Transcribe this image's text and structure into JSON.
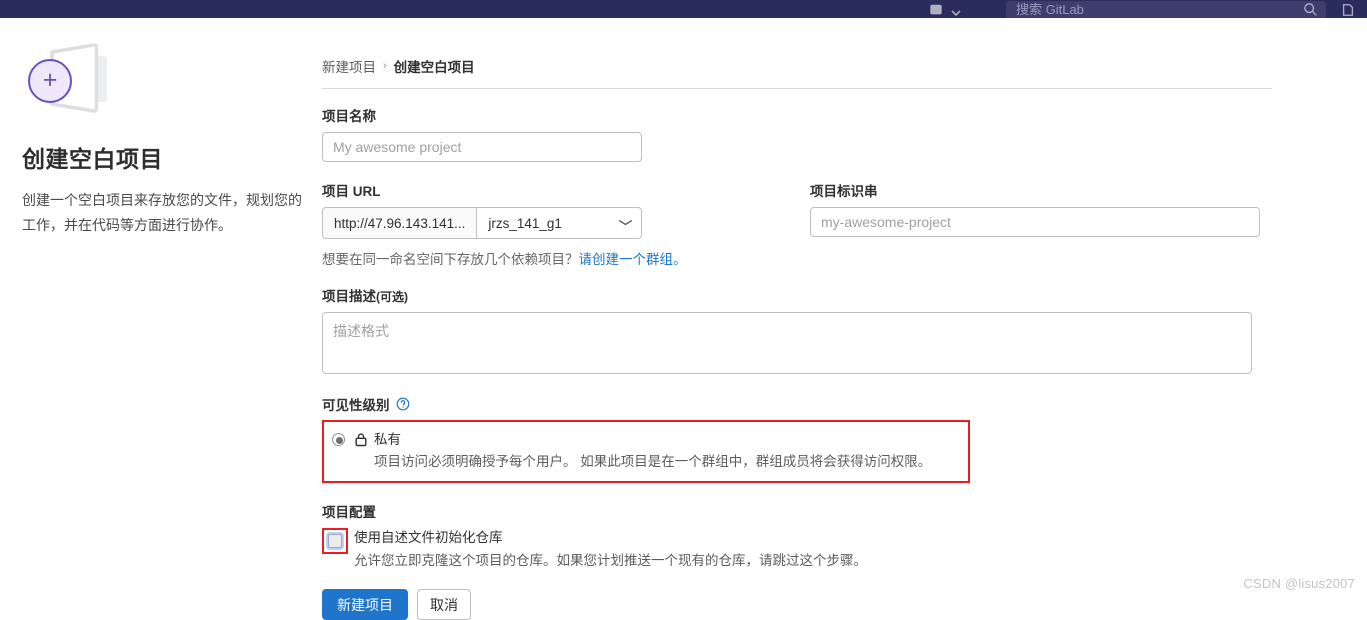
{
  "colors": {
    "navbar": "#2b2c5e",
    "accent_purple": "#6b4fbb",
    "link_blue": "#1f75cb",
    "highlight_red": "#ec1c24",
    "primary_button": "#1f75cb"
  },
  "navbar": {
    "search_placeholder": "搜索 GitLab",
    "icons": [
      "issues-icon",
      "chevron-down-icon",
      "search-icon",
      "merge-request-icon"
    ]
  },
  "side_panel": {
    "illustration": "new-project-folder-plus-icon",
    "title": "创建空白项目",
    "description": "创建一个空白项目来存放您的文件，规划您的工作，并在代码等方面进行协作。"
  },
  "breadcrumb": {
    "parent": "新建项目",
    "separator": "›",
    "current": "创建空白项目"
  },
  "form": {
    "project_name": {
      "label": "项目名称",
      "value": "",
      "placeholder": "My awesome project"
    },
    "project_url": {
      "label": "项目 URL",
      "prefix": "http://47.96.143.141...",
      "namespace_selected": "jrzs_141_g1",
      "chevron": "⌄",
      "helper_text": "想要在同一命名空间下存放几个依赖项目？",
      "helper_link": "请创建一个群组。"
    },
    "project_slug": {
      "label": "项目标识串",
      "value": "",
      "placeholder": "my-awesome-project"
    },
    "project_description": {
      "label": "项目描述",
      "label_optional": "(可选)",
      "value": "",
      "placeholder": "描述格式"
    },
    "visibility": {
      "label": "可见性级别",
      "help_icon": "question-circle-icon",
      "highlighted": true,
      "selected_option": "私有",
      "options": [
        {
          "name": "私有",
          "icon": "lock-icon",
          "description": "项目访问必须明确授予每个用户。 如果此项目是在一个群组中，群组成员将会获得访问权限。",
          "selected": true
        }
      ]
    },
    "project_configuration": {
      "label": "项目配置",
      "checkbox": {
        "label": "使用自述文件初始化仓库",
        "description": "允许您立即克隆这个项目的仓库。如果您计划推送一个现有的仓库，请跳过这个步骤。",
        "checked": false,
        "highlighted": true
      }
    },
    "buttons": {
      "submit": "新建项目",
      "cancel": "取消"
    }
  },
  "watermark": "CSDN @lisus2007"
}
